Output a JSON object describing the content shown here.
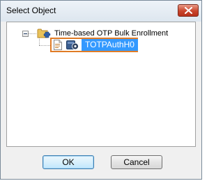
{
  "window": {
    "title": "Select Object"
  },
  "tree": {
    "root": {
      "label": "Time-based OTP Bulk Enrollment",
      "expanded": true
    },
    "children": [
      {
        "label": "TOTPAuthH0",
        "selected": true
      }
    ]
  },
  "buttons": {
    "ok_label": "OK",
    "cancel_label": "Cancel"
  },
  "icons": {
    "close": "close-icon",
    "expander": "collapse-icon",
    "root": "folder-puzzle-icon",
    "child_doc": "document-icon",
    "child_gear": "gear-icon"
  },
  "colors": {
    "selection_bg": "#3399ff",
    "selection_border": "#e07b25",
    "close_button": "#c9452c"
  }
}
